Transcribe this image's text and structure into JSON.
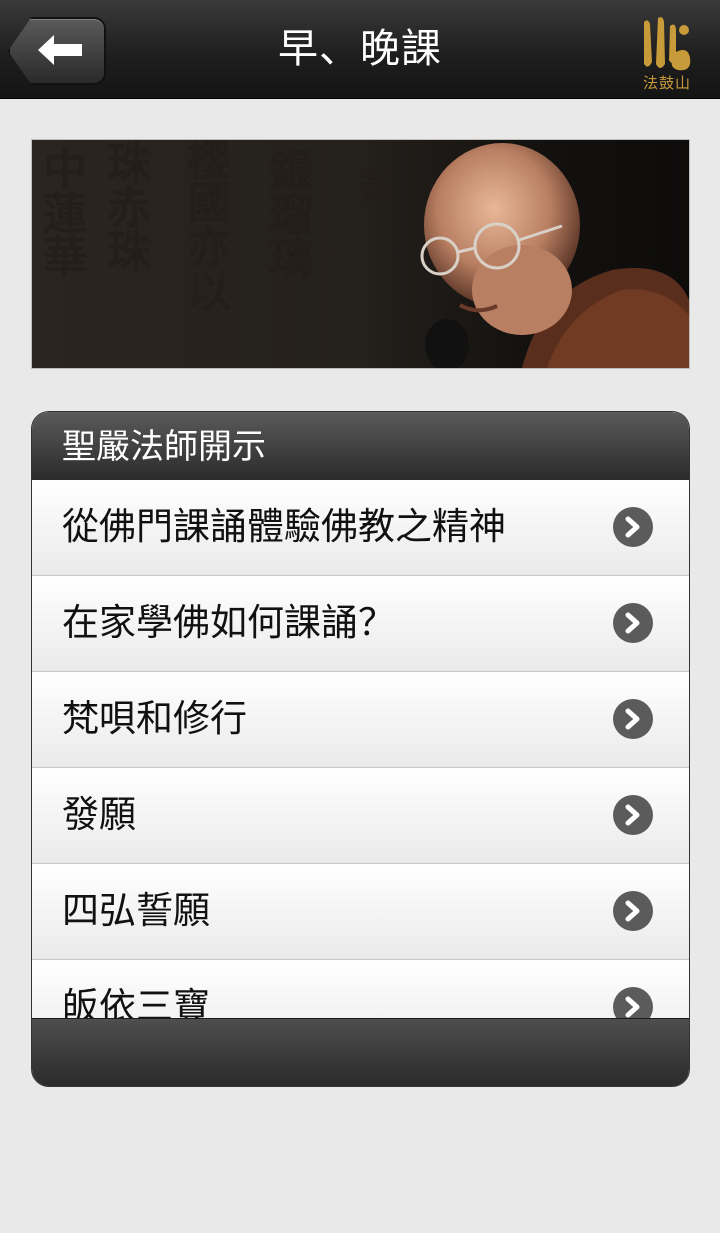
{
  "header": {
    "title": "早、晚課",
    "back_icon": "arrow-left-icon",
    "logo_text": "法鼓山",
    "logo_color": "#c79a3a"
  },
  "banner": {
    "calligraphy": [
      "中",
      "蓮",
      "華",
      "珠",
      "赤",
      "珠",
      "櫻",
      "國",
      "亦",
      "以",
      "銀",
      "瑠",
      "璃",
      "金"
    ]
  },
  "panel": {
    "title": "聖嚴法師開示",
    "items": [
      {
        "label": "從佛門課誦體驗佛教之精神"
      },
      {
        "label": "在家學佛如何課誦？"
      },
      {
        "label": "梵唄和修行"
      },
      {
        "label": "發願"
      },
      {
        "label": "四弘誓願"
      },
      {
        "label": "皈依三寶"
      }
    ],
    "chevron_icon": "chevron-right-icon"
  }
}
